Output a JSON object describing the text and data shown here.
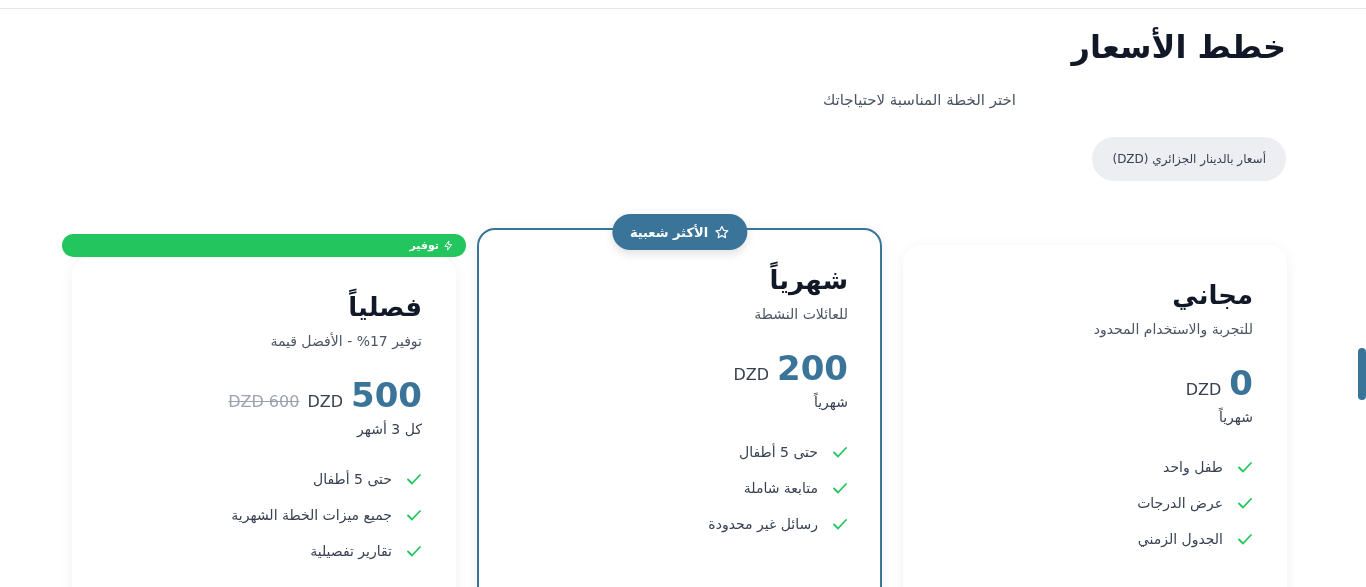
{
  "header": {
    "title": "خطط الأسعار",
    "subtitle": "اختر الخطة المناسبة لاحتياجاتك",
    "currency_note": "أسعار بالدينار الجزائري (DZD)"
  },
  "plans": [
    {
      "name": "مجاني",
      "description": "للتجربة والاستخدام المحدود",
      "price": "0",
      "currency": "DZD",
      "period": "شهرياً",
      "featured": false,
      "features": [
        "طفل واحد",
        "عرض الدرجات",
        "الجدول الزمني"
      ]
    },
    {
      "name": "شهرياً",
      "description": "للعائلات النشطة",
      "price": "200",
      "currency": "DZD",
      "period": "شهرياً",
      "featured": true,
      "badge": {
        "kind": "popular",
        "label": "الأكثر شعبية"
      },
      "features": [
        "حتى 5 أطفال",
        "متابعة شاملة",
        "رسائل غير محدودة"
      ]
    },
    {
      "name": "فصلياً",
      "description": "توفير 17% - الأفضل قيمة",
      "price": "500",
      "currency": "DZD",
      "old_price": "DZD 600",
      "period": "كل 3 أشهر",
      "featured": false,
      "badge": {
        "kind": "saving",
        "label": "توفير"
      },
      "features": [
        "حتى 5 أطفال",
        "جميع ميزات الخطة الشهرية",
        "تقارير تفصيلية"
      ]
    }
  ]
}
